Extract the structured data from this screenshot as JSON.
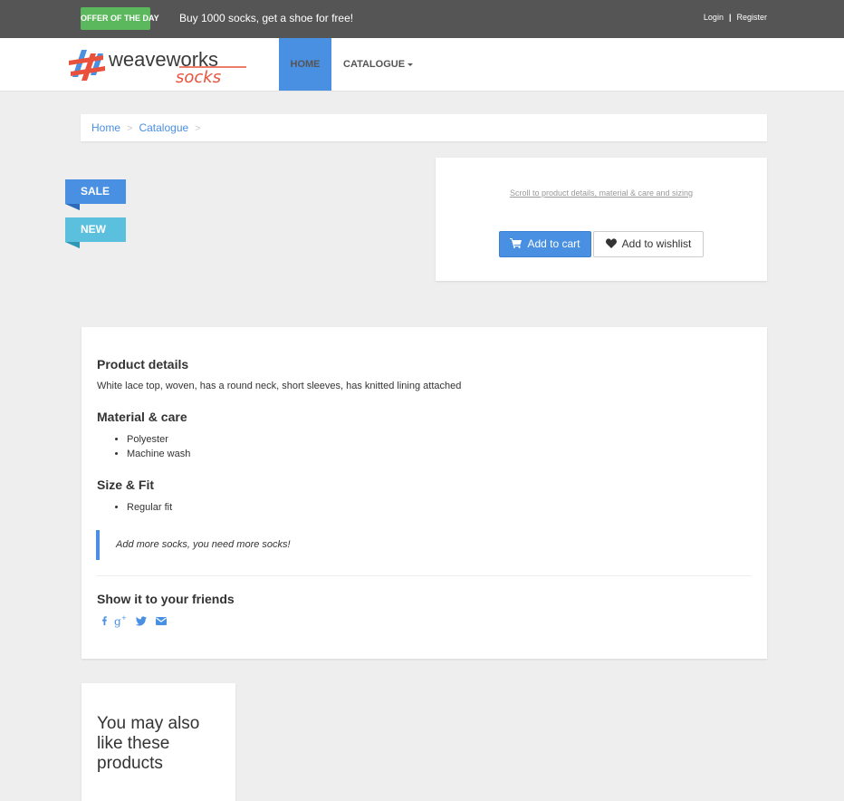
{
  "topbar": {
    "offer_badge": "OFFER OF THE DAY",
    "offer_text": "Buy 1000 socks, get a shoe for free!",
    "login": "Login",
    "separator": "|",
    "register": "Register"
  },
  "navbar": {
    "logo_text_primary": "weaveworks",
    "logo_text_secondary": "socks",
    "home": "HOME",
    "catalogue": "CATALOGUE"
  },
  "breadcrumb": {
    "items": [
      "Home",
      "Catalogue"
    ],
    "separator": ">"
  },
  "ribbons": {
    "sale": "SALE",
    "new": "NEW"
  },
  "buy_box": {
    "scroll_link": "Scroll to product details, material & care and sizing",
    "add_to_cart": "Add to cart",
    "add_to_wishlist": "Add to wishlist"
  },
  "details": {
    "product_details_title": "Product details",
    "product_details_text": "White lace top, woven, has a round neck, short sleeves, has knitted lining attached",
    "material_title": "Material & care",
    "material_items": [
      "Polyester",
      "Machine wash"
    ],
    "size_title": "Size & Fit",
    "size_items": [
      "Regular fit"
    ],
    "quote": "Add more socks, you need more socks!",
    "share_title": "Show it to your friends",
    "social_icons": [
      "facebook-icon",
      "google-plus-icon",
      "twitter-icon",
      "email-icon"
    ]
  },
  "also_like": {
    "title": "You may also like these products"
  },
  "colors": {
    "accent": "#4a90e2",
    "offer_green": "#5cb85c",
    "new_ribbon": "#5bc0de",
    "topbar": "#555555",
    "background": "#eeeeee"
  }
}
